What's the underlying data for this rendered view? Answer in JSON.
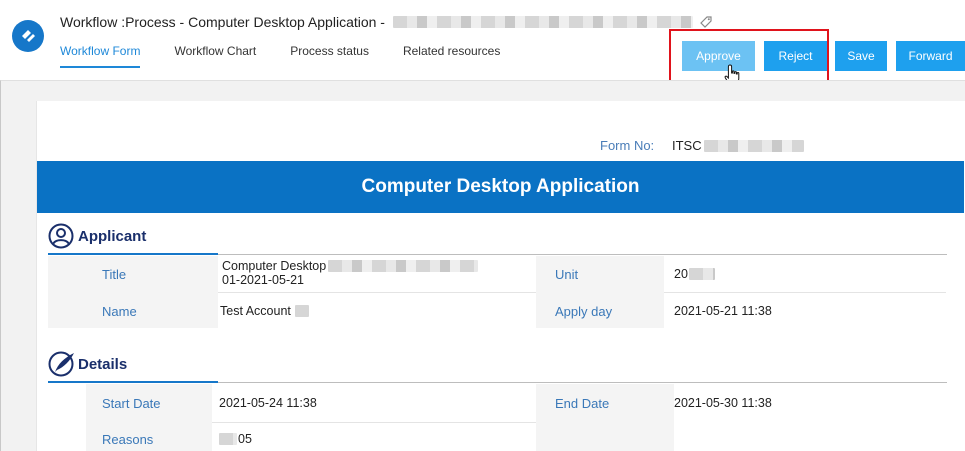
{
  "header": {
    "title": "Workflow :Process - Computer Desktop Application -",
    "tabs": [
      "Workflow Form",
      "Workflow Chart",
      "Process status",
      "Related resources"
    ],
    "buttons": {
      "approve": "Approve",
      "reject": "Reject",
      "save": "Save",
      "forward": "Forward"
    }
  },
  "form": {
    "form_no_label": "Form No:",
    "form_no_value": "ITSC",
    "banner_title": "Computer Desktop Application"
  },
  "applicant": {
    "section_title": "Applicant",
    "title_label": "Title",
    "title_value_line1": "Computer Desktop",
    "title_value_line2": "01-2021-05-21",
    "unit_label": "Unit",
    "unit_value": "20",
    "name_label": "Name",
    "name_value": "Test Account",
    "apply_day_label": "Apply day",
    "apply_day_value": "2021-05-21 11:38"
  },
  "details": {
    "section_title": "Details",
    "start_date_label": "Start Date",
    "start_date_value": "2021-05-24 11:38",
    "end_date_label": "End Date",
    "end_date_value": "2021-05-30 11:38",
    "reasons_label": "Reasons",
    "reasons_value": "05"
  },
  "colors": {
    "accent": "#1e88d8",
    "banner": "#0a72c4",
    "button": "#1ea0ee",
    "highlight": "#e0131c"
  },
  "icons": [
    "app-logo-icon",
    "tag-icon",
    "user-circle-icon",
    "quill-pen-icon",
    "hand-cursor-icon"
  ]
}
